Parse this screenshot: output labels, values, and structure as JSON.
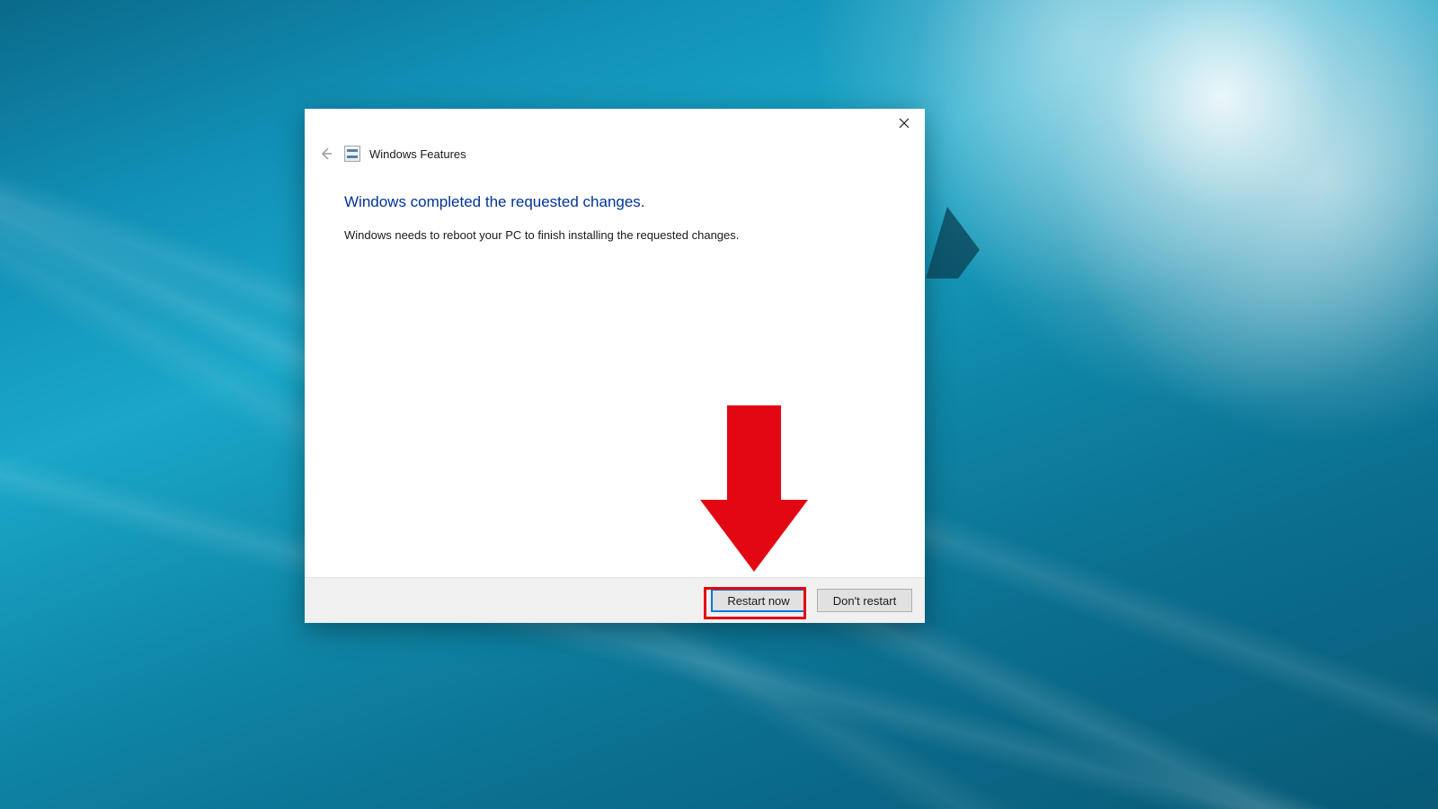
{
  "dialog": {
    "title": "Windows Features",
    "heading": "Windows completed the requested changes.",
    "body": "Windows needs to reboot your PC to finish installing the requested changes.",
    "buttons": {
      "restart": "Restart now",
      "dont_restart": "Don't restart"
    }
  },
  "annotation": {
    "arrow_color": "#e30613",
    "highlight_target": "restart-now-button"
  }
}
